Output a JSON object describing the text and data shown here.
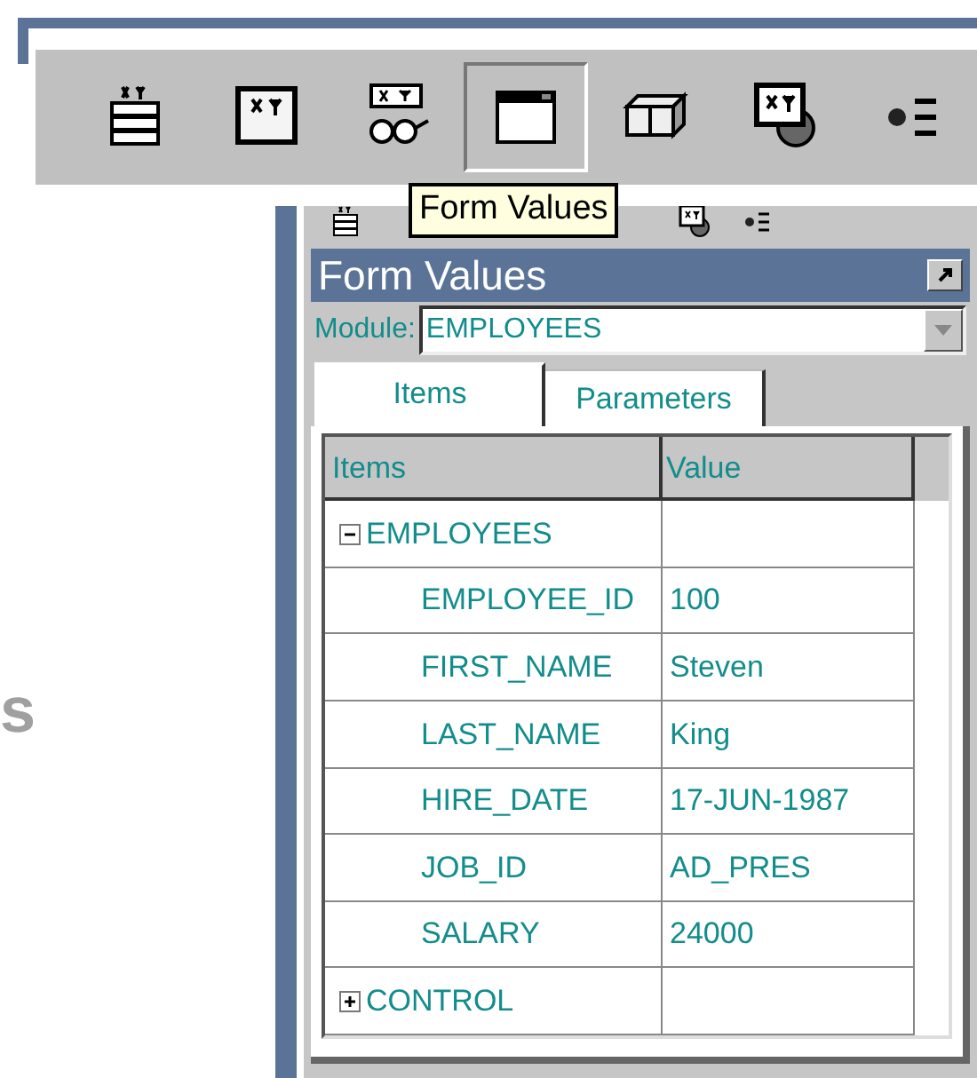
{
  "background_text": "s",
  "toolbar": {
    "tools": [
      {
        "selected": false
      },
      {
        "selected": false
      },
      {
        "selected": false
      },
      {
        "selected": true
      },
      {
        "selected": false
      },
      {
        "selected": false
      },
      {
        "selected": false
      }
    ]
  },
  "tooltip": "Form Values",
  "panel": {
    "title": "Form Values",
    "module_label": "Module:",
    "module_value": "EMPLOYEES",
    "tabs": [
      {
        "label": "Items",
        "selected": true
      },
      {
        "label": "Parameters",
        "selected": false
      }
    ],
    "table": {
      "columns": [
        "Items",
        "Value"
      ],
      "rows": [
        {
          "item": "EMPLOYEES",
          "expanded": true,
          "children": [
            {
              "item": "EMPLOYEE_ID",
              "value": "100"
            },
            {
              "item": "FIRST_NAME",
              "value": "Steven"
            },
            {
              "item": "LAST_NAME",
              "value": "King"
            },
            {
              "item": "HIRE_DATE",
              "value": "17-JUN-1987"
            },
            {
              "item": "JOB_ID",
              "value": "AD_PRES"
            },
            {
              "item": "SALARY",
              "value": "24000"
            }
          ]
        },
        {
          "item": "CONTROL",
          "expanded": false
        }
      ]
    }
  }
}
